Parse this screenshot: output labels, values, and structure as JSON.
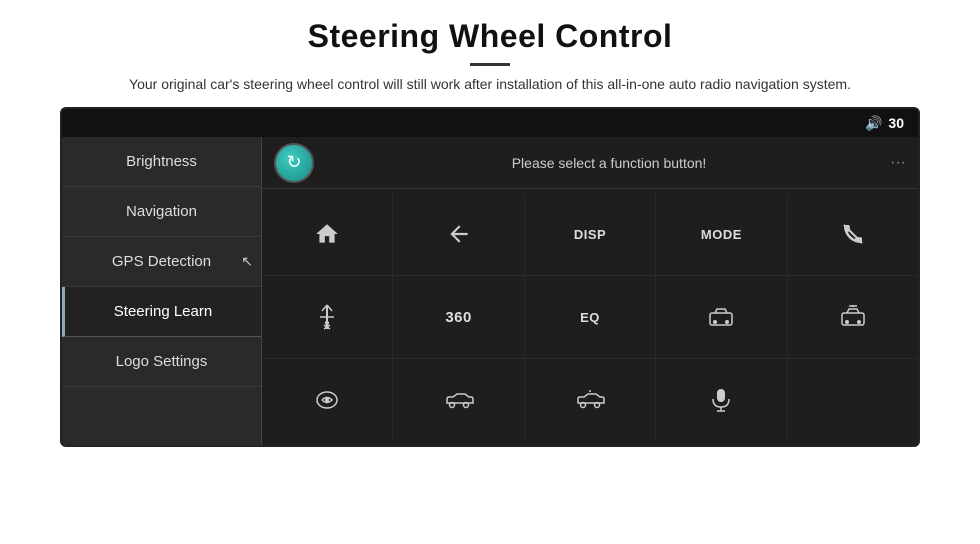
{
  "header": {
    "title": "Steering Wheel Control",
    "description": "Your original car's steering wheel control will still work after installation of this all-in-one auto radio navigation system."
  },
  "topbar": {
    "volume_icon": "🔊",
    "volume_value": "30"
  },
  "sidebar": {
    "items": [
      {
        "id": "brightness",
        "label": "Brightness",
        "active": false
      },
      {
        "id": "navigation",
        "label": "Navigation",
        "active": false
      },
      {
        "id": "gps-detection",
        "label": "GPS Detection",
        "active": false
      },
      {
        "id": "steering-learn",
        "label": "Steering Learn",
        "active": true
      },
      {
        "id": "logo-settings",
        "label": "Logo Settings",
        "active": false
      }
    ]
  },
  "content": {
    "prompt": "Please select a function button!",
    "grid": {
      "row1": [
        {
          "type": "home",
          "label": ""
        },
        {
          "type": "back",
          "label": ""
        },
        {
          "type": "text",
          "label": "DISP"
        },
        {
          "type": "text",
          "label": "MODE"
        },
        {
          "type": "no-call",
          "label": ""
        }
      ],
      "row2": [
        {
          "type": "antenna",
          "label": ""
        },
        {
          "type": "text",
          "label": "360"
        },
        {
          "type": "text",
          "label": "EQ"
        },
        {
          "type": "car-icon1",
          "label": ""
        },
        {
          "type": "car-icon2",
          "label": ""
        }
      ],
      "row3": [
        {
          "type": "car-top",
          "label": ""
        },
        {
          "type": "car-side1",
          "label": ""
        },
        {
          "type": "car-side2",
          "label": ""
        },
        {
          "type": "mic",
          "label": ""
        },
        {
          "type": "empty",
          "label": ""
        }
      ]
    }
  }
}
